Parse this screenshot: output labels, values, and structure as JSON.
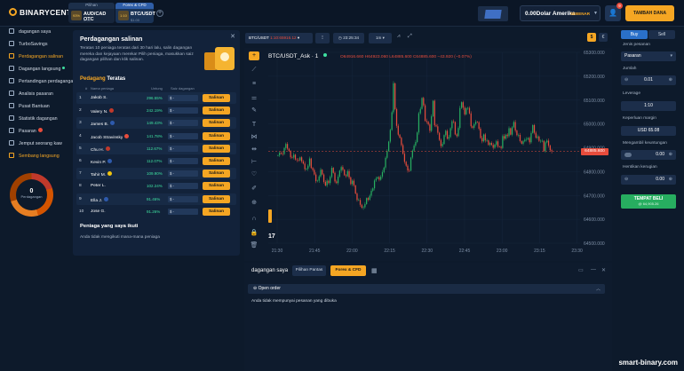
{
  "brand": {
    "name": "BINARYCENT"
  },
  "assets": [
    {
      "header": "Pilihan",
      "pct": "93%",
      "name": "AUD/CAD OTC",
      "sub": "0.95"
    },
    {
      "header": "Forex & CFD",
      "pct": "1:10",
      "name": "BTC/USDT",
      "sub": "$1.00"
    }
  ],
  "account": {
    "balance": "0.00Dolar Amerika",
    "mode": "SEBENAR",
    "notifications": "9",
    "deposit": "TAMBAH DANA"
  },
  "sidebar": {
    "items": [
      {
        "label": "dagangan saya"
      },
      {
        "label": "TurboSavings"
      },
      {
        "label": "Perdagangan salinan"
      },
      {
        "label": "Dagangan langsung"
      },
      {
        "label": "Pertandingan perdagangan"
      },
      {
        "label": "Analisis pasaran"
      },
      {
        "label": "Pusat Bantuan"
      },
      {
        "label": "Statistik dagangan"
      },
      {
        "label": "Pasaran"
      },
      {
        "label": "Jemput seorang kaw"
      },
      {
        "label": "Sembang langsung"
      }
    ],
    "donut": {
      "count": "0",
      "label": "Perdagangan"
    }
  },
  "copy": {
    "title": "Perdagangan salinan",
    "description": "Teratas 10 peniaga teratas dari 30 hari lalu, salin dagangan mereka dan kejayaan mereka! Pilih peniaga, masukkan saiz dagangan pilihan dan klik salinan.",
    "top_label": "Pedagang",
    "top_label2": "Teratas",
    "col_name": "Nama peniaga",
    "col_profit": "Untung",
    "col_amount": "Saiz dagangan",
    "traders": [
      {
        "n": "1",
        "name": "Jakob S.",
        "flag": "",
        "profit": "296.55%",
        "amount": "$ -",
        "copy": "Salinan"
      },
      {
        "n": "2",
        "name": "Valery N.",
        "flag": "#c0392b",
        "profit": "242.19%",
        "amount": "$ -",
        "copy": "Salinan"
      },
      {
        "n": "3",
        "name": "James B.",
        "flag": "#2e5aac",
        "profit": "149.43%",
        "amount": "$ -",
        "copy": "Salinan"
      },
      {
        "n": "4",
        "name": "Jacob Stravinsky",
        "flag": "#e74c3c",
        "profit": "141.78%",
        "amount": "$ -",
        "copy": "Salinan"
      },
      {
        "n": "5",
        "name": "Chu H.",
        "flag": "#c0392b",
        "profit": "112.67%",
        "amount": "$ -",
        "copy": "Salinan"
      },
      {
        "n": "6",
        "name": "Kevin P.",
        "flag": "#2e5aac",
        "profit": "112.07%",
        "amount": "$ -",
        "copy": "Salinan"
      },
      {
        "n": "7",
        "name": "Tahir M.",
        "flag": "#f1c40f",
        "profit": "109.90%",
        "amount": "$ -",
        "copy": "Salinan"
      },
      {
        "n": "8",
        "name": "Peter L.",
        "flag": "",
        "profit": "102.24%",
        "amount": "$ -",
        "copy": "Salinan"
      },
      {
        "n": "9",
        "name": "Ella J.",
        "flag": "#2e5aac",
        "profit": "91.46%",
        "amount": "$ -",
        "copy": "Salinan"
      },
      {
        "n": "10",
        "name": "Jose G.",
        "flag": "",
        "profit": "91.26%",
        "amount": "$ -",
        "copy": "Salinan"
      }
    ],
    "follow_title": "Peniaga yang saya ikuti",
    "follow_none": "Anda tidak mengikuti mana-mana peniaga"
  },
  "chart": {
    "symbol": "BTC/USDT",
    "price": "1:10:65916.12",
    "time": "23:25:34",
    "interval": "1m",
    "legend": "BTC/USDT_Ask · 1",
    "o": "O64916.660",
    "h": "H64923.060",
    "l": "L64885.600",
    "c": "C64885.600",
    "chg": "−43.920 (−0.07%)",
    "current": "64885.600",
    "cur_a": "$",
    "cur_b": "€"
  },
  "chart_data": {
    "type": "candlestick",
    "x": [
      "21:30",
      "21:45",
      "22:00",
      "22:15",
      "22:30",
      "22:45",
      "23:00",
      "23:15",
      "23:30"
    ],
    "y_ticks": [
      "65300.000",
      "65200.000",
      "65100.000",
      "65000.000",
      "64900.000",
      "64800.000",
      "64700.000",
      "64600.000",
      "64500.000"
    ],
    "ylim": [
      64500,
      65300
    ],
    "series": [
      {
        "values": [
          64868,
          64879,
          64875,
          64874,
          64899,
          64916,
          64896,
          64886,
          64860,
          64859,
          64871,
          64851,
          64849,
          64847,
          64860,
          64843,
          64834,
          64810,
          64812,
          64825,
          64855,
          64815,
          64807,
          64788,
          64760,
          64762,
          64780,
          64808,
          64788,
          64757,
          64742,
          64762,
          64752,
          64778,
          64816,
          64795,
          64759,
          64752,
          64779,
          64804,
          64819,
          64808,
          64785,
          64781,
          64802,
          64776,
          64748,
          64762,
          64742,
          64708,
          64681,
          64681,
          64661,
          64649,
          64651,
          64664,
          64689,
          64682,
          64699,
          64720,
          64730,
          64763,
          64771,
          64777,
          64766,
          64779,
          64798,
          64817,
          64858,
          64886,
          64926,
          64975,
          65049,
          65170,
          65062,
          64992,
          64955,
          64942,
          64911,
          64875,
          64841,
          64825,
          64805,
          64804,
          64859,
          64888,
          64909,
          64924,
          64964,
          65045,
          65063,
          65109,
          65078,
          65013,
          65009,
          64998,
          64971,
          65032,
          65097,
          64994,
          64990,
          64963,
          64933,
          64907,
          64916,
          64953,
          64971,
          64938,
          64945,
          64982,
          65011,
          65008,
          64956,
          64949,
          64983,
          65067,
          65091,
          65068,
          65040,
          65066,
          65067,
          65044,
          64990,
          64984,
          64999,
          65009,
          65007,
          64980,
          64941,
          64927,
          64956,
          64931,
          64931,
          64912,
          64920,
          64912,
          64900,
          64913,
          64927,
          64905,
          64904,
          64899,
          64949,
          64938,
          64955,
          64949,
          64982,
          64955,
          64986,
          65008,
          64972,
          64953,
          64954,
          64928,
          64917,
          64927,
          64934,
          64936,
          64941,
          64923,
          64962,
          64995,
          64963,
          64942,
          64947,
          64929,
          64929,
          64929,
          64886,
          64923,
          64930,
          64909,
          64890,
          64885
        ]
      }
    ]
  },
  "tools": [
    {
      "name": "crosshair-icon",
      "glyph": "+"
    },
    {
      "name": "trendline-icon",
      "glyph": "⟋"
    },
    {
      "name": "hline-icon",
      "glyph": "≡"
    },
    {
      "name": "fib-icon",
      "glyph": "⚌"
    },
    {
      "name": "brush-icon",
      "glyph": "✎"
    },
    {
      "name": "text-icon",
      "glyph": "T"
    },
    {
      "name": "pattern-icon",
      "glyph": "⋈"
    },
    {
      "name": "ruler-icon",
      "glyph": "⇹"
    },
    {
      "name": "measure-icon",
      "glyph": "⊢"
    },
    {
      "name": "heart-icon",
      "glyph": "♡"
    },
    {
      "name": "pencil-icon",
      "glyph": "✐"
    },
    {
      "name": "zoom-icon",
      "glyph": "⊕"
    },
    {
      "name": "magnet-icon",
      "glyph": "∩"
    },
    {
      "name": "lock-icon",
      "glyph": "🔒"
    },
    {
      "name": "trash-icon",
      "glyph": "🗑"
    }
  ],
  "tv_logo": "17",
  "bottom": {
    "title": "dagangan saya",
    "tab1": "Pilihan Pantas",
    "tab2": "Forex & CFD",
    "open": "Open order",
    "none": "Anda tidak mempunyai pesanan yang dibuka"
  },
  "order": {
    "buy": "Buy",
    "sell": "Sell",
    "type_label": "Jenis pesanan",
    "type_value": "Pasaran",
    "amount_label": "Jumlah",
    "amount_value": "0.01",
    "leverage_label": "Leverage",
    "leverage_value": "1:10",
    "margin_label": "Keperluan margin",
    "margin_value": "USD 65.08",
    "tp_label": "Mengambil keuntungan",
    "tp_value": "0.00",
    "sl_label": "Hentikan kerugian",
    "sl_value": "0.00",
    "place": "TEMPAT BELI",
    "place_sub": "@ 64,905.26"
  },
  "watermark": "smart-binary.com",
  "colors": {
    "accent": "#f5a623",
    "up": "#27ae60",
    "down": "#e74c3c",
    "bg": "#0d1a2b"
  }
}
